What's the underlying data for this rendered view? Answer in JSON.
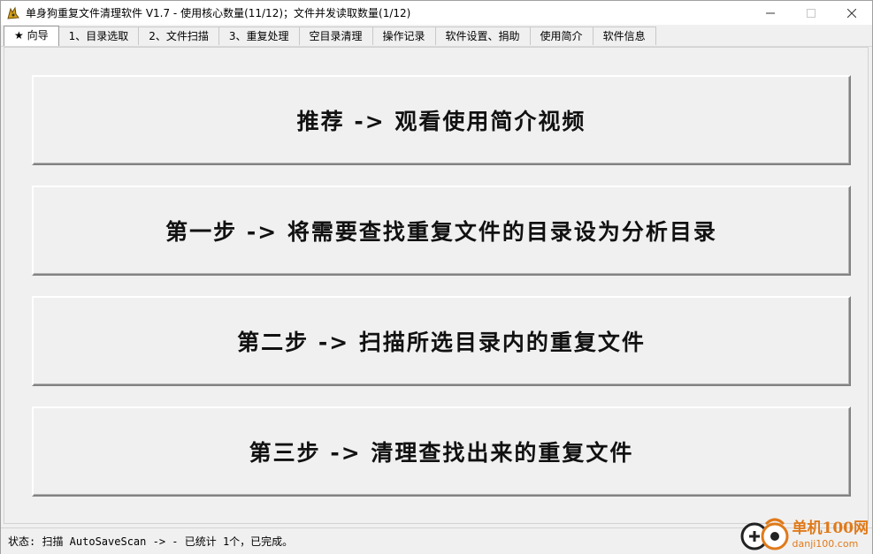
{
  "window": {
    "title": "单身狗重复文件清理软件 V1.7  -  使用核心数量(11/12)；文件并发读取数量(1/12)",
    "controls": {
      "minimize": "—",
      "maximize": "☐",
      "close": "✕"
    }
  },
  "tabs": [
    {
      "label": "★ 向导",
      "active": true
    },
    {
      "label": "1、目录选取",
      "active": false
    },
    {
      "label": "2、文件扫描",
      "active": false
    },
    {
      "label": "3、重复处理",
      "active": false
    },
    {
      "label": "空目录清理",
      "active": false
    },
    {
      "label": "操作记录",
      "active": false
    },
    {
      "label": "软件设置、捐助",
      "active": false
    },
    {
      "label": "使用简介",
      "active": false
    },
    {
      "label": "软件信息",
      "active": false
    }
  ],
  "wizard": {
    "buttons": [
      {
        "label": "推荐 -> 观看使用简介视频"
      },
      {
        "label": "第一步 -> 将需要查找重复文件的目录设为分析目录"
      },
      {
        "label": "第二步 -> 扫描所选目录内的重复文件"
      },
      {
        "label": "第三步 -> 清理查找出来的重复文件"
      }
    ]
  },
  "status": {
    "text": "状态: 扫描 AutoSaveScan -> - 已统计 1个，已完成。"
  },
  "watermark": {
    "cn": "单机100网",
    "en": "danji100.com"
  },
  "colors": {
    "accent_watermark": "#e07a1a",
    "window_bg": "#f0f0f0"
  }
}
